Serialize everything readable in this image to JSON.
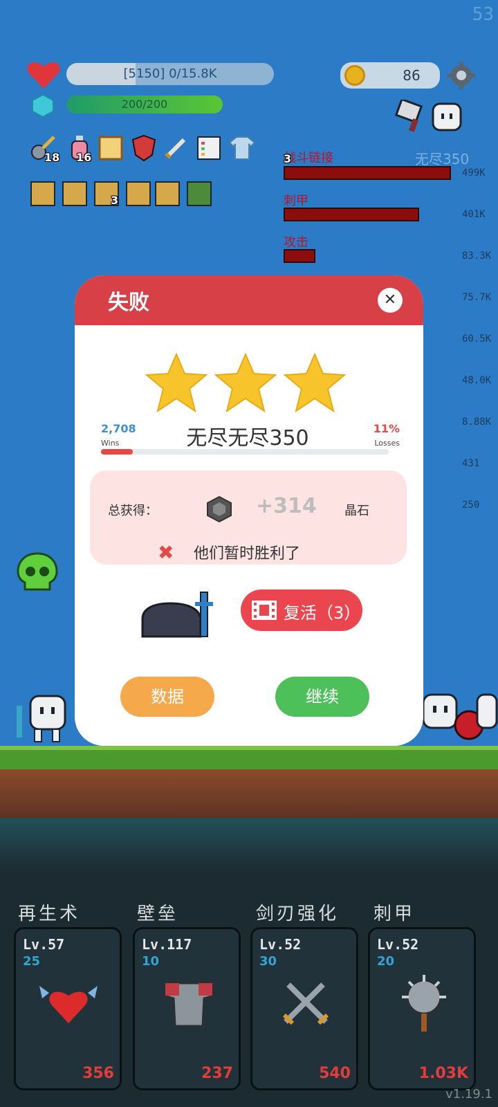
{
  "hud": {
    "fps": "53",
    "hp_text": "[5150] 0/15.8K",
    "mp_text": "200/200",
    "coins": "86",
    "buff_counts": [
      "18",
      "16"
    ],
    "item_count": "3"
  },
  "ranking": {
    "top_label": "战斗链接",
    "top_badge": "3",
    "mode": "无尽350",
    "rows": [
      {
        "label": "刺甲",
        "value": "401K"
      },
      {
        "label": "攻击",
        "value": "83.3K"
      }
    ],
    "first_value": "499K",
    "values": [
      "75.7K",
      "60.5K",
      "48.0K",
      "8.88K",
      "431",
      "250"
    ]
  },
  "dialog": {
    "title": "失败",
    "close": "✕",
    "stars": 3,
    "wins_count": "2,708",
    "wins_label": "Wins",
    "loss_percent": "11%",
    "loss_label": "Losses",
    "mode_name": "无尽无尽350",
    "loss_fraction": 0.11,
    "reward_label": "总获得：",
    "reward_value": "+314",
    "reward_unit": "晶石",
    "status_text": "他们暂时胜利了",
    "revive_label": "复活（3）",
    "data_button": "数据",
    "continue_button": "继续"
  },
  "skills": [
    {
      "name": "再生术",
      "level": "Lv.57",
      "sub": "25",
      "cost": "356",
      "icon": "winged-heart-icon"
    },
    {
      "name": "壁垒",
      "level": "Lv.117",
      "sub": "10",
      "cost": "237",
      "icon": "armor-icon"
    },
    {
      "name": "剑刃强化",
      "level": "Lv.52",
      "sub": "30",
      "cost": "540",
      "icon": "crossed-swords-icon"
    },
    {
      "name": "刺甲",
      "level": "Lv.52",
      "sub": "20",
      "cost": "1.03K",
      "icon": "spiked-mace-icon"
    }
  ],
  "version": "v1.19.1",
  "colors": {
    "primary_red": "#d84048",
    "revive_red": "#eb4650",
    "data_orange": "#f5a94a",
    "continue_green": "#4dc05a",
    "sky_blue": "#2b7bc6"
  }
}
